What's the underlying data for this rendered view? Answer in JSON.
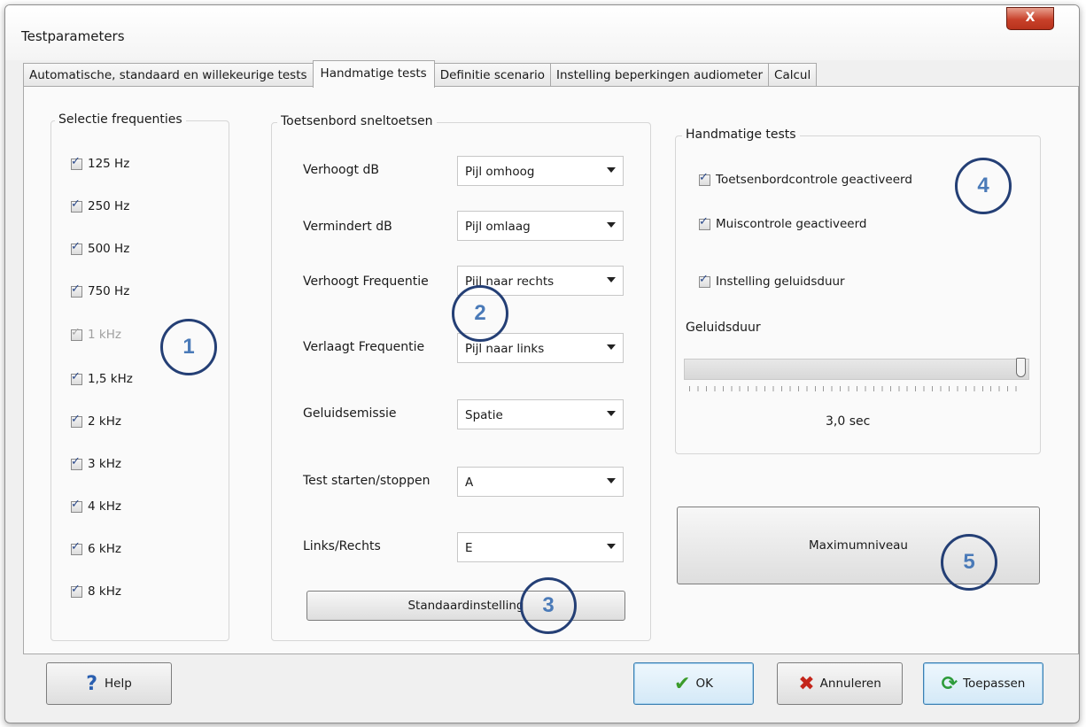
{
  "window": {
    "title": "Testparameters",
    "close_label": "X"
  },
  "tabs": [
    {
      "label": "Automatische, standaard en willekeurige tests",
      "active": false
    },
    {
      "label": "Handmatige tests",
      "active": true
    },
    {
      "label": "Definitie scenario",
      "active": false
    },
    {
      "label": "Instelling beperkingen audiometer",
      "active": false
    },
    {
      "label": "Calcul",
      "active": false
    }
  ],
  "frequencies": {
    "legend": "Selectie frequenties",
    "items": [
      {
        "label": "125 Hz",
        "checked": true,
        "enabled": true
      },
      {
        "label": "250 Hz",
        "checked": true,
        "enabled": true
      },
      {
        "label": "500 Hz",
        "checked": true,
        "enabled": true
      },
      {
        "label": "750 Hz",
        "checked": true,
        "enabled": true
      },
      {
        "label": "1 kHz",
        "checked": true,
        "enabled": false
      },
      {
        "label": "1,5 kHz",
        "checked": true,
        "enabled": true
      },
      {
        "label": "2 kHz",
        "checked": true,
        "enabled": true
      },
      {
        "label": "3 kHz",
        "checked": true,
        "enabled": true
      },
      {
        "label": "4 kHz",
        "checked": true,
        "enabled": true
      },
      {
        "label": "6 kHz",
        "checked": true,
        "enabled": true
      },
      {
        "label": "8 kHz",
        "checked": true,
        "enabled": true
      }
    ]
  },
  "shortcuts": {
    "legend": "Toetsenbord sneltoetsen",
    "rows": [
      {
        "label": "Verhoogt dB",
        "value": "Pijl omhoog"
      },
      {
        "label": "Vermindert dB",
        "value": "Pijl omlaag"
      },
      {
        "label": "Verhoogt Frequentie",
        "value": "Pijl naar rechts"
      },
      {
        "label": "Verlaagt Frequentie",
        "value": "Pijl naar links"
      },
      {
        "label": "Geluidsemissie",
        "value": "Spatie"
      },
      {
        "label": "Test starten/stoppen",
        "value": "A"
      },
      {
        "label": "Links/Rechts",
        "value": "E"
      }
    ],
    "default_button": "Standaardinstelling"
  },
  "manual_tests": {
    "legend": "Handmatige tests",
    "options": [
      {
        "label": "Toetsenbordcontrole geactiveerd",
        "checked": true
      },
      {
        "label": "Muiscontrole geactiveerd",
        "checked": true
      },
      {
        "label": "Instelling geluidsduur",
        "checked": true
      }
    ],
    "duration_label": "Geluidsduur",
    "duration_value": "3,0 sec",
    "slider_level": 1.0
  },
  "max_level_button": "Maximumniveau",
  "callouts": [
    "1",
    "2",
    "3",
    "4",
    "5"
  ],
  "footer": {
    "help": "Help",
    "ok": "OK",
    "cancel": "Annuleren",
    "apply": "Toepassen"
  },
  "colors": {
    "callout_border": "#243f75",
    "callout_text": "#4a7ab8",
    "check_tick": "#2c4a8a"
  }
}
